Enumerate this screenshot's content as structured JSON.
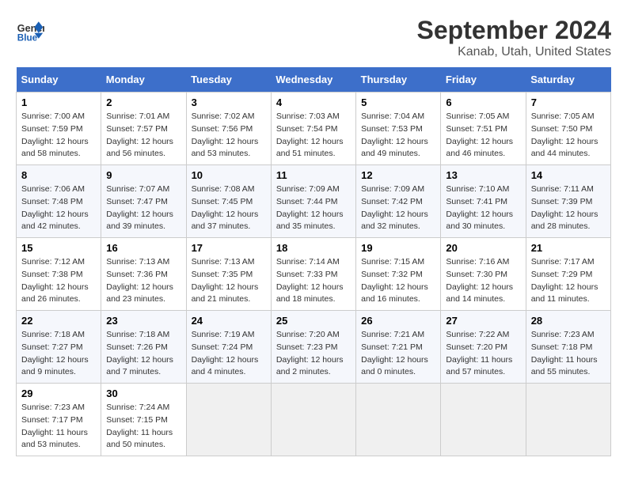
{
  "header": {
    "logo_line1": "General",
    "logo_line2": "Blue",
    "title": "September 2024",
    "subtitle": "Kanab, Utah, United States"
  },
  "columns": [
    "Sunday",
    "Monday",
    "Tuesday",
    "Wednesday",
    "Thursday",
    "Friday",
    "Saturday"
  ],
  "weeks": [
    [
      {
        "day": "1",
        "sunrise": "7:00 AM",
        "sunset": "7:59 PM",
        "daylight": "12 hours and 58 minutes."
      },
      {
        "day": "2",
        "sunrise": "7:01 AM",
        "sunset": "7:57 PM",
        "daylight": "12 hours and 56 minutes."
      },
      {
        "day": "3",
        "sunrise": "7:02 AM",
        "sunset": "7:56 PM",
        "daylight": "12 hours and 53 minutes."
      },
      {
        "day": "4",
        "sunrise": "7:03 AM",
        "sunset": "7:54 PM",
        "daylight": "12 hours and 51 minutes."
      },
      {
        "day": "5",
        "sunrise": "7:04 AM",
        "sunset": "7:53 PM",
        "daylight": "12 hours and 49 minutes."
      },
      {
        "day": "6",
        "sunrise": "7:05 AM",
        "sunset": "7:51 PM",
        "daylight": "12 hours and 46 minutes."
      },
      {
        "day": "7",
        "sunrise": "7:05 AM",
        "sunset": "7:50 PM",
        "daylight": "12 hours and 44 minutes."
      }
    ],
    [
      {
        "day": "8",
        "sunrise": "7:06 AM",
        "sunset": "7:48 PM",
        "daylight": "12 hours and 42 minutes."
      },
      {
        "day": "9",
        "sunrise": "7:07 AM",
        "sunset": "7:47 PM",
        "daylight": "12 hours and 39 minutes."
      },
      {
        "day": "10",
        "sunrise": "7:08 AM",
        "sunset": "7:45 PM",
        "daylight": "12 hours and 37 minutes."
      },
      {
        "day": "11",
        "sunrise": "7:09 AM",
        "sunset": "7:44 PM",
        "daylight": "12 hours and 35 minutes."
      },
      {
        "day": "12",
        "sunrise": "7:09 AM",
        "sunset": "7:42 PM",
        "daylight": "12 hours and 32 minutes."
      },
      {
        "day": "13",
        "sunrise": "7:10 AM",
        "sunset": "7:41 PM",
        "daylight": "12 hours and 30 minutes."
      },
      {
        "day": "14",
        "sunrise": "7:11 AM",
        "sunset": "7:39 PM",
        "daylight": "12 hours and 28 minutes."
      }
    ],
    [
      {
        "day": "15",
        "sunrise": "7:12 AM",
        "sunset": "7:38 PM",
        "daylight": "12 hours and 26 minutes."
      },
      {
        "day": "16",
        "sunrise": "7:13 AM",
        "sunset": "7:36 PM",
        "daylight": "12 hours and 23 minutes."
      },
      {
        "day": "17",
        "sunrise": "7:13 AM",
        "sunset": "7:35 PM",
        "daylight": "12 hours and 21 minutes."
      },
      {
        "day": "18",
        "sunrise": "7:14 AM",
        "sunset": "7:33 PM",
        "daylight": "12 hours and 18 minutes."
      },
      {
        "day": "19",
        "sunrise": "7:15 AM",
        "sunset": "7:32 PM",
        "daylight": "12 hours and 16 minutes."
      },
      {
        "day": "20",
        "sunrise": "7:16 AM",
        "sunset": "7:30 PM",
        "daylight": "12 hours and 14 minutes."
      },
      {
        "day": "21",
        "sunrise": "7:17 AM",
        "sunset": "7:29 PM",
        "daylight": "12 hours and 11 minutes."
      }
    ],
    [
      {
        "day": "22",
        "sunrise": "7:18 AM",
        "sunset": "7:27 PM",
        "daylight": "12 hours and 9 minutes."
      },
      {
        "day": "23",
        "sunrise": "7:18 AM",
        "sunset": "7:26 PM",
        "daylight": "12 hours and 7 minutes."
      },
      {
        "day": "24",
        "sunrise": "7:19 AM",
        "sunset": "7:24 PM",
        "daylight": "12 hours and 4 minutes."
      },
      {
        "day": "25",
        "sunrise": "7:20 AM",
        "sunset": "7:23 PM",
        "daylight": "12 hours and 2 minutes."
      },
      {
        "day": "26",
        "sunrise": "7:21 AM",
        "sunset": "7:21 PM",
        "daylight": "12 hours and 0 minutes."
      },
      {
        "day": "27",
        "sunrise": "7:22 AM",
        "sunset": "7:20 PM",
        "daylight": "11 hours and 57 minutes."
      },
      {
        "day": "28",
        "sunrise": "7:23 AM",
        "sunset": "7:18 PM",
        "daylight": "11 hours and 55 minutes."
      }
    ],
    [
      {
        "day": "29",
        "sunrise": "7:23 AM",
        "sunset": "7:17 PM",
        "daylight": "11 hours and 53 minutes."
      },
      {
        "day": "30",
        "sunrise": "7:24 AM",
        "sunset": "7:15 PM",
        "daylight": "11 hours and 50 minutes."
      },
      null,
      null,
      null,
      null,
      null
    ]
  ]
}
